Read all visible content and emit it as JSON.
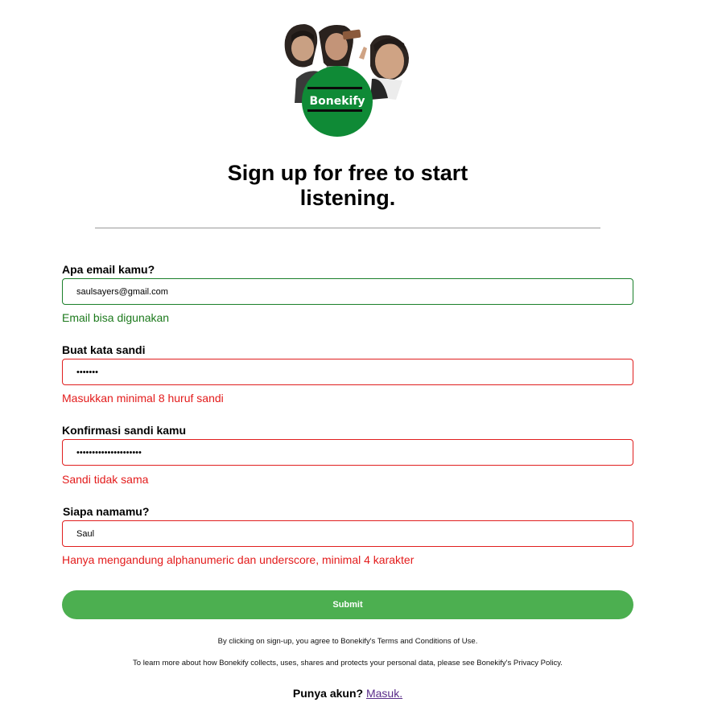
{
  "brand": {
    "logo_text": "Bonekify",
    "color": "#0f8a36"
  },
  "heading": {
    "line1": "Sign up for free to start",
    "line2": "listening."
  },
  "form": {
    "email": {
      "label": "Apa email kamu?",
      "value": "saulsayers@gmail.com",
      "message": "Email bisa digunakan",
      "status": "valid"
    },
    "password": {
      "label": "Buat kata sandi",
      "value": "•••••••",
      "message": "Masukkan minimal 8 huruf sandi",
      "status": "error"
    },
    "confirm_password": {
      "label": "Konfirmasi sandi kamu",
      "value": "•••••••••••••••••••••",
      "message": "Sandi tidak sama",
      "status": "error"
    },
    "name": {
      "label": "Siapa namamu?",
      "value": "Saul",
      "message": "Hanya mengandung alphanumeric dan underscore, minimal 4 karakter",
      "status": "error"
    },
    "submit_label": "Submit"
  },
  "legal": {
    "terms": "By clicking on sign-up, you agree to Bonekify's Terms and Conditions of Use.",
    "privacy": "To learn more about how Bonekify collects, uses, shares and protects your personal data, please see Bonekify's Privacy Policy."
  },
  "login": {
    "question": "Punya akun?",
    "link_text": "Masuk."
  },
  "colors": {
    "accent_button": "#4caf50",
    "valid": "#1d7a1d",
    "error": "#e31b1b"
  }
}
